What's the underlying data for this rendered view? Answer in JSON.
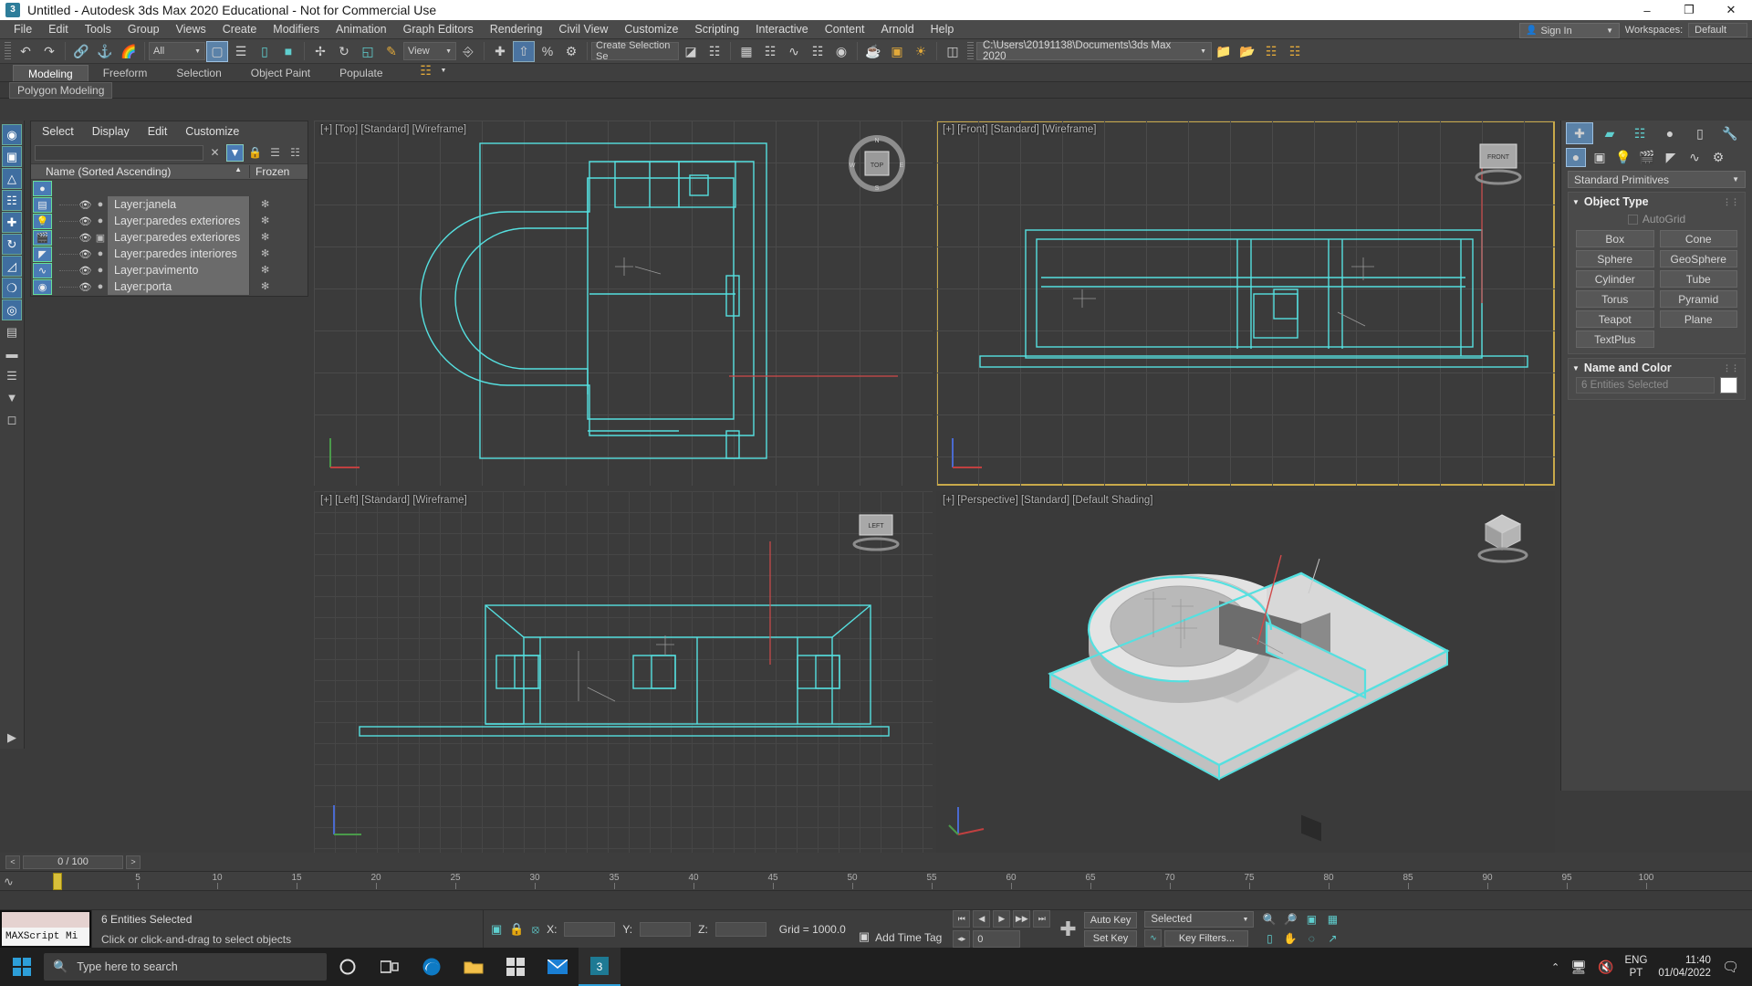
{
  "window": {
    "title": "Untitled - Autodesk 3ds Max 2020 Educational - Not for Commercial Use",
    "app_icon": "3",
    "minimize": "–",
    "maximize": "❐",
    "close": "✕"
  },
  "menu": {
    "items": [
      "File",
      "Edit",
      "Tools",
      "Group",
      "Views",
      "Create",
      "Modifiers",
      "Animation",
      "Graph Editors",
      "Rendering",
      "Civil View",
      "Customize",
      "Scripting",
      "Interactive",
      "Content",
      "Arnold",
      "Help"
    ],
    "sign_in": "Sign In",
    "workspaces_label": "Workspaces:",
    "workspace_value": "Default"
  },
  "toolbar": {
    "undo": "↶",
    "redo": "↷",
    "select_link": "link-icon",
    "unlink": "unlink-icon",
    "bind_space_warp": "bind-icon",
    "selection_filter": "All",
    "select_object": "select-object-icon",
    "select_by_name": "select-by-name-icon",
    "rect_select": "rectangular-select-icon",
    "window_crossing": "window-crossing-icon",
    "select_move": "select-and-move-icon",
    "select_rotate": "select-and-rotate-icon",
    "select_scale": "select-and-scale-icon",
    "placement": "placement-icon",
    "ref_coord_system": "View",
    "use_pivot": "pivot-center-icon",
    "snap_toggle": "snap-icon",
    "angle_snap": "angle-snap-icon",
    "percent_snap": "percent-snap-icon",
    "spinner_snap": "spinner-snap-icon",
    "named_sel_sets": "Create Selection Se",
    "mirror": "mirror-icon",
    "align": "align-icon",
    "layer_explorer": "layer-explorer-icon",
    "curve_editor": "curve-editor-icon",
    "schematic_view": "schematic-view-icon",
    "material_editor": "material-editor-icon",
    "render_setup": "render-setup-icon",
    "rendered_frame": "rendered-frame-icon",
    "render_production": "render-production-icon",
    "project_path": "C:\\Users\\20191138\\Documents\\3ds Max 2020"
  },
  "ribbon": {
    "tabs": [
      "Modeling",
      "Freeform",
      "Selection",
      "Object Paint",
      "Populate"
    ],
    "active_tab": "Modeling",
    "subtab": "Polygon Modeling"
  },
  "layer_explorer": {
    "menu": [
      "Select",
      "Display",
      "Edit",
      "Customize"
    ],
    "search_value": "",
    "clear_icon": "clear-icon",
    "filter_icon": "filter-icon",
    "lock_icon": "lock-icon",
    "columns": {
      "name": "Name (Sorted Ascending)",
      "sort": "▲",
      "frozen": "Frozen"
    },
    "rows": [
      {
        "name": "Layer:janela",
        "visible": true,
        "type": "layer"
      },
      {
        "name": "Layer:paredes exteriores",
        "visible": true,
        "type": "layer"
      },
      {
        "name": "Layer:paredes exteriores",
        "visible": true,
        "type": "layer-nested"
      },
      {
        "name": "Layer:paredes interiores",
        "visible": true,
        "type": "layer"
      },
      {
        "name": "Layer:pavimento",
        "visible": true,
        "type": "layer"
      },
      {
        "name": "Layer:porta",
        "visible": true,
        "type": "layer"
      }
    ],
    "side_buttons": [
      "objects-icon",
      "layers-icon",
      "lights-icon",
      "cameras-icon",
      "helpers-icon",
      "spacewarps-icon",
      "materials-icon"
    ]
  },
  "viewports": [
    {
      "id": "top",
      "label": "[+] [Top] [Standard] [Wireframe]",
      "active": false,
      "cube": "TOP",
      "shading": "wireframe"
    },
    {
      "id": "front",
      "label": "[+] [Front] [Standard] [Wireframe]",
      "active": true,
      "cube": "FRONT",
      "shading": "wireframe"
    },
    {
      "id": "left",
      "label": "[+] [Left] [Standard] [Wireframe]",
      "active": false,
      "cube": "LEFT",
      "shading": "wireframe"
    },
    {
      "id": "perspective",
      "label": "[+] [Perspective] [Standard] [Default Shading]",
      "active": false,
      "cube": "PERSP",
      "shading": "shaded"
    }
  ],
  "command_panel": {
    "tabs": [
      "create-tab",
      "modify-tab",
      "hierarchy-tab",
      "motion-tab",
      "display-tab",
      "utilities-tab"
    ],
    "active_tab": "create-tab",
    "category_icons": [
      "geometry-icon",
      "shapes-icon",
      "lights-icon",
      "cameras-icon",
      "helpers-icon",
      "spacewarps-icon",
      "systems-icon"
    ],
    "dropdown": "Standard Primitives",
    "rollouts": [
      {
        "title": "Object Type",
        "autogrid_label": "AutoGrid",
        "autogrid_checked": false,
        "buttons": [
          "Box",
          "Cone",
          "Sphere",
          "GeoSphere",
          "Cylinder",
          "Tube",
          "Torus",
          "Pyramid",
          "Teapot",
          "Plane",
          "TextPlus"
        ]
      },
      {
        "title": "Name and Color",
        "name_value": "6 Entities Selected",
        "color_swatch": "#ffffff"
      }
    ]
  },
  "time": {
    "frame_display": "0 / 100",
    "prev_label": "<",
    "next_label": ">",
    "ticks": [
      0,
      5,
      10,
      15,
      20,
      25,
      30,
      35,
      40,
      45,
      50,
      55,
      60,
      65,
      70,
      75,
      80,
      85,
      90,
      95,
      100
    ],
    "current_frame": 0
  },
  "status": {
    "maxscript_label": "MAXScript Mi",
    "selection_text": "6 Entities Selected",
    "hint_text": "Click or click-and-drag to select objects",
    "lock_icon": "lock-selection-icon",
    "absolute_mode_icon": "absolute-mode-transform-icon",
    "selection_region_icon": "selection-region-icon",
    "x_label": "X:",
    "y_label": "Y:",
    "z_label": "Z:",
    "x_value": "",
    "y_value": "",
    "z_value": "",
    "grid_text": "Grid = 1000.0",
    "add_time_tag": "Add Time Tag",
    "auto_key": "Auto Key",
    "set_key": "Set Key",
    "key_mode": "Selected",
    "key_filters": "Key Filters...",
    "nav_icons": [
      "zoom-icon",
      "zoom-all-icon",
      "zoom-extents-icon",
      "zoom-extents-selected-icon",
      "zoom-region-icon",
      "pan-icon",
      "orbit-icon",
      "maximize-viewport-icon"
    ],
    "anim_buttons": [
      "goto-start-icon",
      "prev-frame-icon",
      "play-icon",
      "next-frame-icon",
      "goto-end-icon"
    ],
    "current_frame_field": "0"
  },
  "taskbar": {
    "start_icon": "windows-start-icon",
    "search_placeholder": "Type here to search",
    "icons": [
      "cortana-icon",
      "task-view-icon",
      "edge-icon",
      "file-explorer-icon",
      "store-icon",
      "mail-icon",
      "3dsmax-icon"
    ],
    "tray": {
      "expand": "⌃",
      "network": "network-icon",
      "volume": "volume-muted-icon",
      "lang_top": "ENG",
      "lang_bot": "PT",
      "time": "11:40",
      "date": "01/04/2022",
      "notifications": "notifications-icon"
    }
  },
  "colors": {
    "accent_blue": "#4a7bb5",
    "selection_cyan": "#55e0e0",
    "active_viewport": "#c8a94a",
    "panel_bg": "#3f3f3f",
    "toolbar_bg": "#444444"
  }
}
